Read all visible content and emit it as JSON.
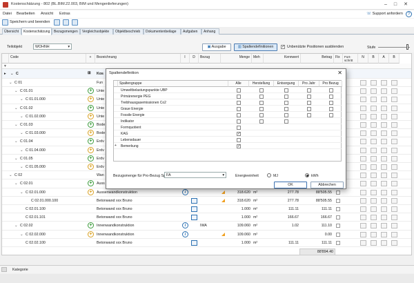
{
  "window": {
    "title": "Kostenschätzung - 802 (BL.BIM.22.003, BIM und Mengenlieferungen)",
    "min": "–",
    "max": "□",
    "close": "✕"
  },
  "menu": {
    "items": [
      "Datei",
      "Bearbeiten",
      "Ansicht",
      "Extras"
    ],
    "support": "Support anfordern",
    "help": "?"
  },
  "toolbar": {
    "save_close": "Speichern und beenden"
  },
  "tabs": [
    "Übersicht",
    "Kostenschätzung",
    "Bezugsmengen",
    "Vergleichsobjekte",
    "Objektbeschrieb",
    "Dokumentenbeilage",
    "Aufgaben",
    "Anhang"
  ],
  "filter": {
    "teilobjekt_label": "Teilobjekt",
    "teilobjekt_value": "WOHNH",
    "ausgabe": "Ausgabe",
    "spaltendef": "Spaltendefinitionen",
    "hide_unused": "Unbenützte Positionen ausblenden",
    "stufe": "Stufe"
  },
  "grid": {
    "headers": {
      "code": "Code",
      "plus": "+",
      "bez": "Bezeichnung",
      "i": "I",
      "d": "D",
      "bezug": "Bezug",
      "menge": "Menge",
      "meh": "Meh",
      "kennwert": "Kennwert",
      "betrag": "Betrag",
      "fix": "Fix",
      "fort": "Fort-schritt",
      "n": "N",
      "b": "B",
      "a": "A",
      "bb": "B"
    },
    "root": {
      "code": "C",
      "bez": "Kos"
    },
    "rows": [
      {
        "code": "C 01",
        "bez": "Fun",
        "plus": "",
        "ind": 1
      },
      {
        "code": "C 01.01",
        "bez": "Unte",
        "plus": "g",
        "ind": 2
      },
      {
        "code": "C 01.01.000",
        "bez": "Unte",
        "plus": "y",
        "ind": 3
      },
      {
        "code": "C 01.02",
        "bez": "Unte",
        "plus": "g",
        "ind": 2
      },
      {
        "code": "C 01.02.000",
        "bez": "Unte",
        "plus": "y",
        "ind": 3
      },
      {
        "code": "C 01.03",
        "bez": "Bode",
        "plus": "g",
        "ind": 2
      },
      {
        "code": "C 01.03.000",
        "bez": "Bode",
        "plus": "y",
        "ind": 3
      },
      {
        "code": "C 01.04",
        "bez": "Erdv",
        "plus": "g",
        "ind": 2
      },
      {
        "code": "C 01.04.000",
        "bez": "Erdv",
        "plus": "y",
        "ind": 3
      },
      {
        "code": "C 01.05",
        "bez": "Erdv",
        "plus": "g",
        "ind": 2
      },
      {
        "code": "C 01.05.000",
        "bez": "Erdv",
        "plus": "y",
        "ind": 3
      },
      {
        "code": "C 02",
        "bez": "Wan",
        "plus": "",
        "ind": 1
      },
      {
        "code": "C 02.01",
        "bez": "Auss",
        "plus": "g",
        "ind": 2
      },
      {
        "code": "C 02.01.000",
        "bez": "Aussenwandkonstruktion",
        "plus": "y",
        "ind": 3,
        "info": true,
        "tri": true,
        "menge": "318.620",
        "meh": "m²",
        "kw": "277.78",
        "betrag": "88'505.55"
      },
      {
        "code": "C 02.01.000.100",
        "bez": "Betonwand xxx Bruno",
        "plus": "",
        "ind": 4,
        "edit": true,
        "tri": true,
        "menge": "318.620",
        "meh": "m²",
        "kw": "277.78",
        "betrag": "88'505.55"
      },
      {
        "code": "C 02.01.100",
        "bez": "Betonwand xxx Bruno",
        "plus": "",
        "ind": 3,
        "edit": true,
        "menge": "1.000",
        "meh": "m²",
        "kw": "111.11",
        "betrag": "111.11"
      },
      {
        "code": "C 02.01.101",
        "bez": "Betonwand xxx Bruno",
        "plus": "",
        "ind": 3,
        "edit": true,
        "menge": "1.000",
        "meh": "m²",
        "kw": "166.67",
        "betrag": "166.67"
      },
      {
        "code": "C 02.02",
        "bez": "Innenwandkonstruktion",
        "plus": "g",
        "ind": 2,
        "info": true,
        "bezug": "IWA",
        "menge": "109.060",
        "meh": "m²",
        "kw": "1.02",
        "betrag": "111.10"
      },
      {
        "code": "C 02.02.000",
        "bez": "Innenwandkonstruktion",
        "plus": "y",
        "ind": 3,
        "info": true,
        "tri": true,
        "menge": "109.060",
        "meh": "m²",
        "betrag": "0.00"
      },
      {
        "code": "C 02.02.100",
        "bez": "Betonwand xxx Bruno",
        "plus": "",
        "ind": 3,
        "edit": true,
        "menge": "1.000",
        "meh": "m²",
        "kw": "111.11",
        "betrag": "111.11"
      }
    ],
    "total": "88'894.40"
  },
  "status": {
    "kategorie": "Kategorie"
  },
  "dialog": {
    "title": "Spaltendefinition",
    "close": "✕",
    "headers": [
      "Spaltengruppe",
      "Alle",
      "Herstellung",
      "Entsorgung",
      "Pro Jahr",
      "Pro Bezug"
    ],
    "rows": [
      {
        "label": "Umweltbelastungspunkte UBP",
        "cols": 5
      },
      {
        "label": "Primärenergie PEG",
        "cols": 5
      },
      {
        "label": "Treibhausgasemissionen Co2",
        "cols": 5
      },
      {
        "label": "Graue Energie",
        "cols": 5
      },
      {
        "label": "Fossile Energie",
        "cols": 5
      },
      {
        "label": "Indikator",
        "cols": 3
      },
      {
        "label": "Formquotient",
        "cols": 1
      },
      {
        "label": "KAG",
        "cols": 1,
        "checked": true
      },
      {
        "label": "Lebensdauer",
        "cols": 1
      },
      {
        "label": "Bemerkung",
        "cols": 1,
        "checked": true,
        "marker": "+"
      }
    ],
    "bezug_label": "Bezugsmenge für Pro-Bezug Spalte",
    "bezug_value": "FA",
    "energie_label": "Energieeinheit",
    "mj": "MJ",
    "kwh": "kWh",
    "ok": "OK",
    "abbrechen": "Abbrechen"
  }
}
